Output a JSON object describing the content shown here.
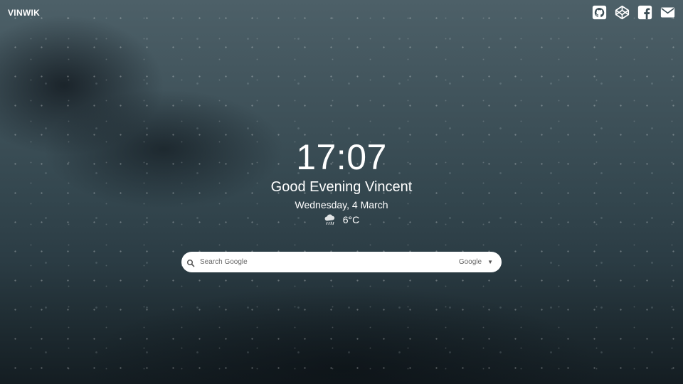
{
  "header": {
    "brand": "VINWIK",
    "social": [
      {
        "name": "github",
        "icon": "github-icon"
      },
      {
        "name": "codepen",
        "icon": "codepen-icon"
      },
      {
        "name": "facebook",
        "icon": "facebook-icon"
      },
      {
        "name": "email",
        "icon": "mail-icon"
      }
    ]
  },
  "main": {
    "time": "17:07",
    "greeting": "Good Evening Vincent",
    "date": "Wednesday, 4 March",
    "weather": {
      "icon": "cloud-rain-icon",
      "temperature": "6°C"
    }
  },
  "search": {
    "placeholder": "Search Google",
    "value": "",
    "engine": "Google",
    "engine_caret": "▼"
  },
  "colors": {
    "text": "#ffffff",
    "search_bg": "#ffffff",
    "search_text": "#666666"
  }
}
